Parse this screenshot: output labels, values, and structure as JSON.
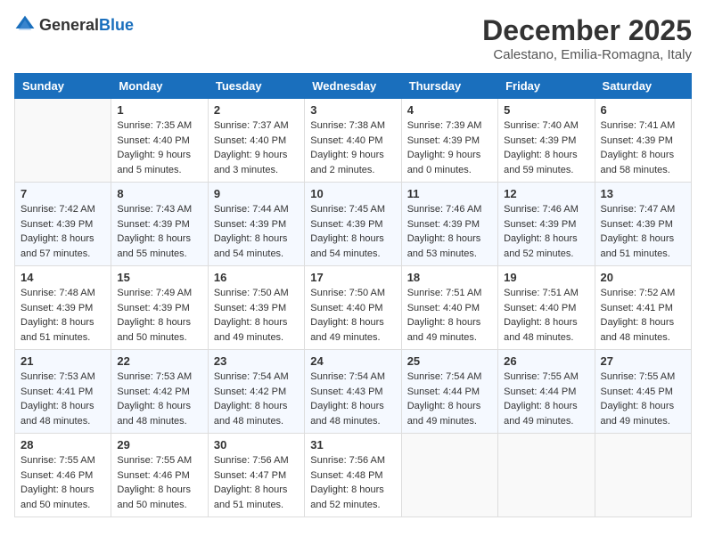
{
  "header": {
    "logo_general": "General",
    "logo_blue": "Blue",
    "month_title": "December 2025",
    "location": "Calestano, Emilia-Romagna, Italy"
  },
  "days_of_week": [
    "Sunday",
    "Monday",
    "Tuesday",
    "Wednesday",
    "Thursday",
    "Friday",
    "Saturday"
  ],
  "weeks": [
    [
      {
        "day": "",
        "info": ""
      },
      {
        "day": "1",
        "info": "Sunrise: 7:35 AM\nSunset: 4:40 PM\nDaylight: 9 hours\nand 5 minutes."
      },
      {
        "day": "2",
        "info": "Sunrise: 7:37 AM\nSunset: 4:40 PM\nDaylight: 9 hours\nand 3 minutes."
      },
      {
        "day": "3",
        "info": "Sunrise: 7:38 AM\nSunset: 4:40 PM\nDaylight: 9 hours\nand 2 minutes."
      },
      {
        "day": "4",
        "info": "Sunrise: 7:39 AM\nSunset: 4:39 PM\nDaylight: 9 hours\nand 0 minutes."
      },
      {
        "day": "5",
        "info": "Sunrise: 7:40 AM\nSunset: 4:39 PM\nDaylight: 8 hours\nand 59 minutes."
      },
      {
        "day": "6",
        "info": "Sunrise: 7:41 AM\nSunset: 4:39 PM\nDaylight: 8 hours\nand 58 minutes."
      }
    ],
    [
      {
        "day": "7",
        "info": "Sunrise: 7:42 AM\nSunset: 4:39 PM\nDaylight: 8 hours\nand 57 minutes."
      },
      {
        "day": "8",
        "info": "Sunrise: 7:43 AM\nSunset: 4:39 PM\nDaylight: 8 hours\nand 55 minutes."
      },
      {
        "day": "9",
        "info": "Sunrise: 7:44 AM\nSunset: 4:39 PM\nDaylight: 8 hours\nand 54 minutes."
      },
      {
        "day": "10",
        "info": "Sunrise: 7:45 AM\nSunset: 4:39 PM\nDaylight: 8 hours\nand 54 minutes."
      },
      {
        "day": "11",
        "info": "Sunrise: 7:46 AM\nSunset: 4:39 PM\nDaylight: 8 hours\nand 53 minutes."
      },
      {
        "day": "12",
        "info": "Sunrise: 7:46 AM\nSunset: 4:39 PM\nDaylight: 8 hours\nand 52 minutes."
      },
      {
        "day": "13",
        "info": "Sunrise: 7:47 AM\nSunset: 4:39 PM\nDaylight: 8 hours\nand 51 minutes."
      }
    ],
    [
      {
        "day": "14",
        "info": "Sunrise: 7:48 AM\nSunset: 4:39 PM\nDaylight: 8 hours\nand 51 minutes."
      },
      {
        "day": "15",
        "info": "Sunrise: 7:49 AM\nSunset: 4:39 PM\nDaylight: 8 hours\nand 50 minutes."
      },
      {
        "day": "16",
        "info": "Sunrise: 7:50 AM\nSunset: 4:39 PM\nDaylight: 8 hours\nand 49 minutes."
      },
      {
        "day": "17",
        "info": "Sunrise: 7:50 AM\nSunset: 4:40 PM\nDaylight: 8 hours\nand 49 minutes."
      },
      {
        "day": "18",
        "info": "Sunrise: 7:51 AM\nSunset: 4:40 PM\nDaylight: 8 hours\nand 49 minutes."
      },
      {
        "day": "19",
        "info": "Sunrise: 7:51 AM\nSunset: 4:40 PM\nDaylight: 8 hours\nand 48 minutes."
      },
      {
        "day": "20",
        "info": "Sunrise: 7:52 AM\nSunset: 4:41 PM\nDaylight: 8 hours\nand 48 minutes."
      }
    ],
    [
      {
        "day": "21",
        "info": "Sunrise: 7:53 AM\nSunset: 4:41 PM\nDaylight: 8 hours\nand 48 minutes."
      },
      {
        "day": "22",
        "info": "Sunrise: 7:53 AM\nSunset: 4:42 PM\nDaylight: 8 hours\nand 48 minutes."
      },
      {
        "day": "23",
        "info": "Sunrise: 7:54 AM\nSunset: 4:42 PM\nDaylight: 8 hours\nand 48 minutes."
      },
      {
        "day": "24",
        "info": "Sunrise: 7:54 AM\nSunset: 4:43 PM\nDaylight: 8 hours\nand 48 minutes."
      },
      {
        "day": "25",
        "info": "Sunrise: 7:54 AM\nSunset: 4:44 PM\nDaylight: 8 hours\nand 49 minutes."
      },
      {
        "day": "26",
        "info": "Sunrise: 7:55 AM\nSunset: 4:44 PM\nDaylight: 8 hours\nand 49 minutes."
      },
      {
        "day": "27",
        "info": "Sunrise: 7:55 AM\nSunset: 4:45 PM\nDaylight: 8 hours\nand 49 minutes."
      }
    ],
    [
      {
        "day": "28",
        "info": "Sunrise: 7:55 AM\nSunset: 4:46 PM\nDaylight: 8 hours\nand 50 minutes."
      },
      {
        "day": "29",
        "info": "Sunrise: 7:55 AM\nSunset: 4:46 PM\nDaylight: 8 hours\nand 50 minutes."
      },
      {
        "day": "30",
        "info": "Sunrise: 7:56 AM\nSunset: 4:47 PM\nDaylight: 8 hours\nand 51 minutes."
      },
      {
        "day": "31",
        "info": "Sunrise: 7:56 AM\nSunset: 4:48 PM\nDaylight: 8 hours\nand 52 minutes."
      },
      {
        "day": "",
        "info": ""
      },
      {
        "day": "",
        "info": ""
      },
      {
        "day": "",
        "info": ""
      }
    ]
  ]
}
